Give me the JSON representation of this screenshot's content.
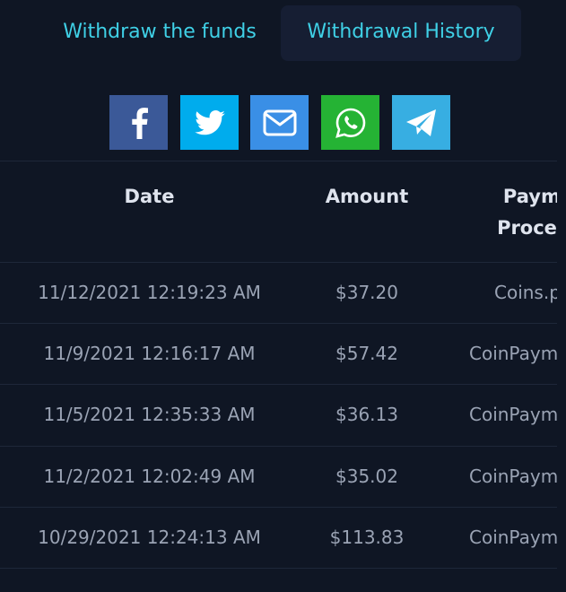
{
  "tabs": [
    {
      "label": "Withdraw the funds",
      "active": false
    },
    {
      "label": "Withdrawal History",
      "active": true
    }
  ],
  "share": {
    "buttons": [
      {
        "name": "facebook",
        "icon": "facebook-icon",
        "color": "#3b5998"
      },
      {
        "name": "twitter",
        "icon": "twitter-icon",
        "color": "#00aced"
      },
      {
        "name": "email",
        "icon": "email-icon",
        "color": "#3a8fe6"
      },
      {
        "name": "whatsapp",
        "icon": "whatsapp-icon",
        "color": "#25b334"
      },
      {
        "name": "telegram",
        "icon": "telegram-icon",
        "color": "#37aee2"
      }
    ]
  },
  "table": {
    "headers": {
      "date": "Date",
      "amount": "Amount",
      "processor_line1": "Payme",
      "processor_line2": "Process"
    },
    "rows": [
      {
        "date": "11/12/2021 12:19:23 AM",
        "amount": "$37.20",
        "processor": "Coins.p"
      },
      {
        "date": "11/9/2021 12:16:17 AM",
        "amount": "$57.42",
        "processor": "CoinPaym"
      },
      {
        "date": "11/5/2021 12:35:33 AM",
        "amount": "$36.13",
        "processor": "CoinPaym"
      },
      {
        "date": "11/2/2021 12:02:49 AM",
        "amount": "$35.02",
        "processor": "CoinPaym"
      },
      {
        "date": "10/29/2021 12:24:13 AM",
        "amount": "$113.83",
        "processor": "CoinPaym"
      }
    ]
  },
  "colors": {
    "background": "#0f1624",
    "accent": "#3fd0e6",
    "active_tab_bg": "#161e33"
  }
}
